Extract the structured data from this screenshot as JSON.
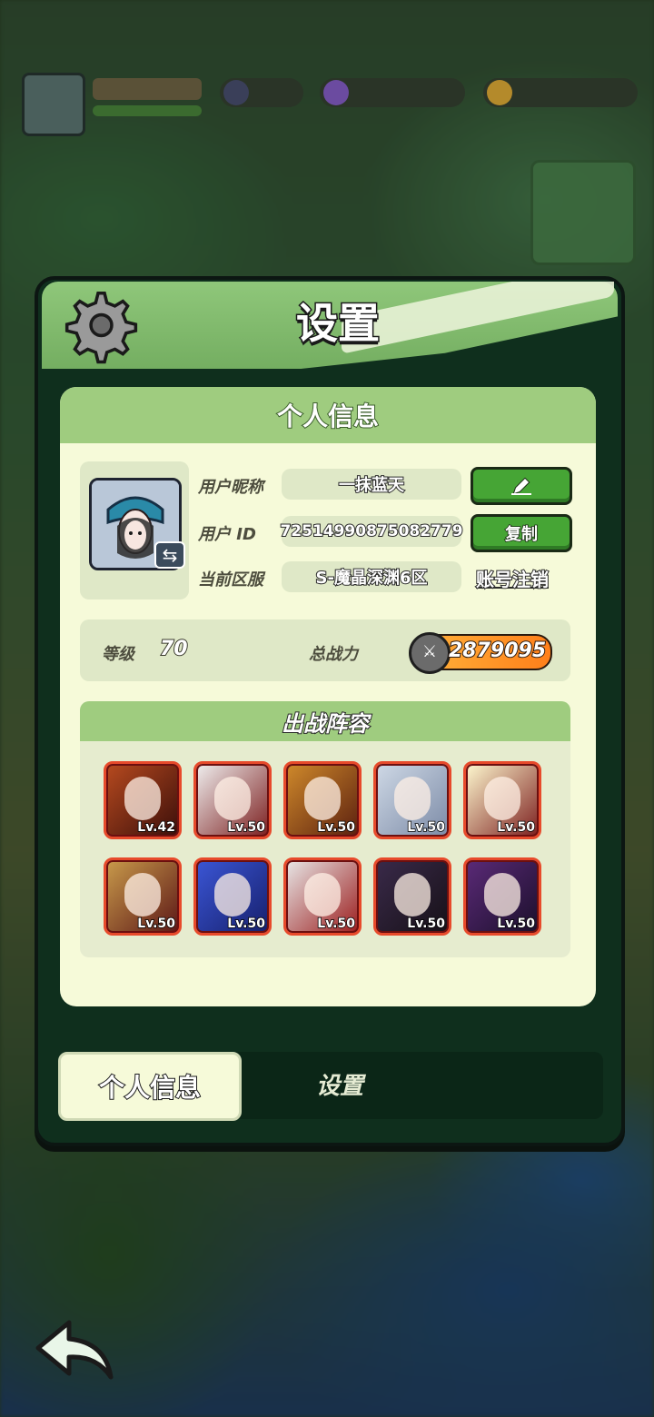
{
  "panel": {
    "title": "设置",
    "section_title": "个人信息"
  },
  "profile": {
    "nickname_label": "用户昵称",
    "nickname_value": "一抹蓝天",
    "id_label": "用户  ID",
    "id_value": "72514990875082779",
    "server_label": "当前区服",
    "server_value": "S-魔晶深渊6区",
    "copy_button": "复制",
    "cancel_account_link": "账号注销"
  },
  "stats": {
    "level_label": "等级",
    "level_value": "70",
    "power_label": "总战力",
    "power_value": "2879095"
  },
  "lineup": {
    "title": "出战阵容",
    "heroes": [
      {
        "level": "Lv.42",
        "colors": [
          "#b74a1f",
          "#3a0e0a"
        ]
      },
      {
        "level": "Lv.50",
        "colors": [
          "#f0f0f0",
          "#7b1d1d"
        ]
      },
      {
        "level": "Lv.50",
        "colors": [
          "#d08a2b",
          "#5a1f0f"
        ]
      },
      {
        "level": "Lv.50",
        "colors": [
          "#cfd9e6",
          "#7b8aa6"
        ]
      },
      {
        "level": "Lv.50",
        "colors": [
          "#fffad0",
          "#7b1d1d"
        ]
      },
      {
        "level": "Lv.50",
        "colors": [
          "#c99b4b",
          "#5b1616"
        ]
      },
      {
        "level": "Lv.50",
        "colors": [
          "#3b56d6",
          "#161f6b"
        ]
      },
      {
        "level": "Lv.50",
        "colors": [
          "#e8e8e8",
          "#9b1c1c"
        ]
      },
      {
        "level": "Lv.50",
        "colors": [
          "#3a2a4a",
          "#161016"
        ]
      },
      {
        "level": "Lv.50",
        "colors": [
          "#5b2a78",
          "#1a0f2a"
        ]
      }
    ]
  },
  "tabs": {
    "active": "个人信息",
    "inactive": "设置"
  },
  "colors": {
    "header_green": "#8fc77a",
    "panel_dark": "#0f2f1d",
    "card_bg": "#f6fad9",
    "accent_button": "#46a535",
    "hero_border": "#e74a2b"
  },
  "icons": {
    "gear": "gear-icon",
    "edit": "pencil-icon",
    "swap": "swap-icon",
    "power": "sword-icon",
    "back": "back-arrow-icon"
  }
}
